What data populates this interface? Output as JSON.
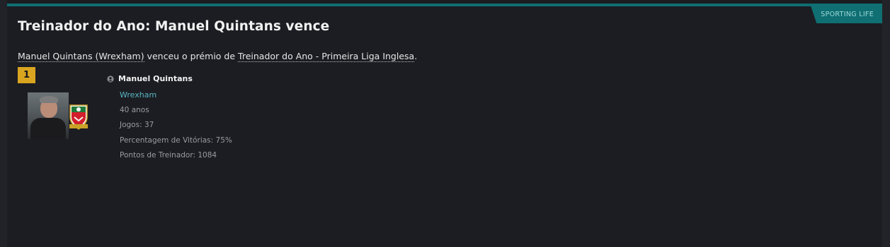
{
  "tag": {
    "label": "SPORTING LIFE"
  },
  "article": {
    "headline": "Treinador do Ano: Manuel Quintans vence",
    "intro": {
      "winner_link": "Manuel Quintans (Wrexham)",
      "middle_text": " venceu o prémio de ",
      "award_link": "Treinador do Ano - Primeira Liga Inglesa",
      "end_text": "."
    }
  },
  "winner": {
    "rank": "1",
    "name": "Manuel Quintans",
    "club": "Wrexham",
    "age": "40 anos",
    "games": "Jogos: 37",
    "win_pct": "Percentagem de Vitórias: 75%",
    "points": "Pontos de Treinador: 1084"
  },
  "colors": {
    "accent": "#0f6f72",
    "rank_badge": "#d9a520",
    "club_link": "#57b6c4",
    "background": "#1c1d22"
  }
}
